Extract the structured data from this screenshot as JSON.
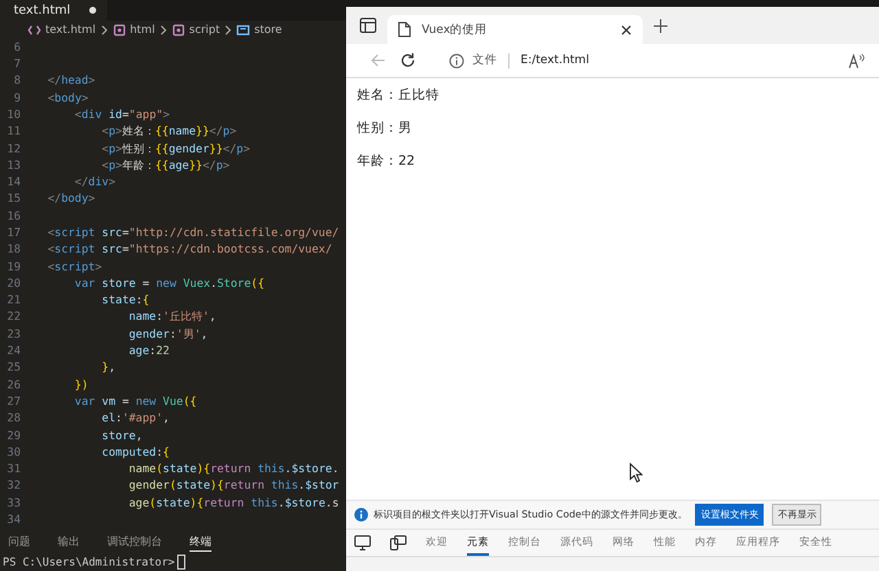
{
  "editor": {
    "tab": {
      "label": "text.html",
      "modified": true
    },
    "breadcrumb": [
      {
        "kind": "file",
        "label": "text.html"
      },
      {
        "kind": "element",
        "label": "html"
      },
      {
        "kind": "element",
        "label": "script"
      },
      {
        "kind": "variable",
        "label": "store"
      }
    ],
    "code": [
      {
        "number": "6"
      },
      {
        "number": "7"
      },
      {
        "number": "8",
        "tokens": [
          {
            "kind": "punct",
            "text": "    </"
          },
          {
            "kind": "tag",
            "text": "head"
          },
          {
            "kind": "punct",
            "text": ">"
          }
        ]
      },
      {
        "number": "9",
        "tokens": [
          {
            "kind": "punct",
            "text": "    <"
          },
          {
            "kind": "tag",
            "text": "body"
          },
          {
            "kind": "punct",
            "text": ">"
          }
        ]
      },
      {
        "number": "10",
        "tokens": [
          {
            "kind": "punct",
            "text": "        <"
          },
          {
            "kind": "tag",
            "text": "div"
          },
          {
            "kind": "attr",
            "text": " id"
          },
          {
            "kind": "plain",
            "text": "="
          },
          {
            "kind": "str",
            "text": "\"app\""
          },
          {
            "kind": "punct",
            "text": ">"
          }
        ]
      },
      {
        "number": "11",
        "tokens": [
          {
            "kind": "punct",
            "text": "            <"
          },
          {
            "kind": "tag",
            "text": "p"
          },
          {
            "kind": "punct",
            "text": ">"
          },
          {
            "kind": "plain",
            "text": "姓名："
          },
          {
            "kind": "brace",
            "text": "{{"
          },
          {
            "kind": "var",
            "text": "name"
          },
          {
            "kind": "brace",
            "text": "}}"
          },
          {
            "kind": "punct",
            "text": "</"
          },
          {
            "kind": "tag",
            "text": "p"
          },
          {
            "kind": "punct",
            "text": ">"
          }
        ]
      },
      {
        "number": "12",
        "tokens": [
          {
            "kind": "punct",
            "text": "            <"
          },
          {
            "kind": "tag",
            "text": "p"
          },
          {
            "kind": "punct",
            "text": ">"
          },
          {
            "kind": "plain",
            "text": "性别："
          },
          {
            "kind": "brace",
            "text": "{{"
          },
          {
            "kind": "var",
            "text": "gender"
          },
          {
            "kind": "brace",
            "text": "}}"
          },
          {
            "kind": "punct",
            "text": "</"
          },
          {
            "kind": "tag",
            "text": "p"
          },
          {
            "kind": "punct",
            "text": ">"
          }
        ]
      },
      {
        "number": "13",
        "tokens": [
          {
            "kind": "punct",
            "text": "            <"
          },
          {
            "kind": "tag",
            "text": "p"
          },
          {
            "kind": "punct",
            "text": ">"
          },
          {
            "kind": "plain",
            "text": "年龄："
          },
          {
            "kind": "brace",
            "text": "{{"
          },
          {
            "kind": "var",
            "text": "age"
          },
          {
            "kind": "brace",
            "text": "}}"
          },
          {
            "kind": "punct",
            "text": "</"
          },
          {
            "kind": "tag",
            "text": "p"
          },
          {
            "kind": "punct",
            "text": ">"
          }
        ]
      },
      {
        "number": "14",
        "tokens": [
          {
            "kind": "punct",
            "text": "        </"
          },
          {
            "kind": "tag",
            "text": "div"
          },
          {
            "kind": "punct",
            "text": ">"
          }
        ]
      },
      {
        "number": "15",
        "tokens": [
          {
            "kind": "punct",
            "text": "    </"
          },
          {
            "kind": "tag",
            "text": "body"
          },
          {
            "kind": "punct",
            "text": ">"
          }
        ]
      },
      {
        "number": "16"
      },
      {
        "number": "17",
        "tokens": [
          {
            "kind": "punct",
            "text": "    <"
          },
          {
            "kind": "tag",
            "text": "script"
          },
          {
            "kind": "attr",
            "text": " src"
          },
          {
            "kind": "plain",
            "text": "="
          },
          {
            "kind": "str",
            "text": "\"http://cdn.staticfile.org/vue/"
          }
        ]
      },
      {
        "number": "18",
        "tokens": [
          {
            "kind": "punct",
            "text": "    <"
          },
          {
            "kind": "tag",
            "text": "script"
          },
          {
            "kind": "attr",
            "text": " src"
          },
          {
            "kind": "plain",
            "text": "="
          },
          {
            "kind": "str",
            "text": "\"https://cdn.bootcss.com/vuex/"
          }
        ]
      },
      {
        "number": "19",
        "tokens": [
          {
            "kind": "punct",
            "text": "    <"
          },
          {
            "kind": "tag",
            "text": "script"
          },
          {
            "kind": "punct",
            "text": ">"
          }
        ]
      },
      {
        "number": "20",
        "tokens": [
          {
            "kind": "keyword",
            "text": "        var"
          },
          {
            "kind": "var",
            "text": " store"
          },
          {
            "kind": "plain",
            "text": " = "
          },
          {
            "kind": "keyword",
            "text": "new"
          },
          {
            "kind": "cls",
            "text": " Vuex"
          },
          {
            "kind": "plain",
            "text": "."
          },
          {
            "kind": "cls",
            "text": "Store"
          },
          {
            "kind": "brace",
            "text": "({"
          }
        ]
      },
      {
        "number": "21",
        "tokens": [
          {
            "kind": "var",
            "text": "            state"
          },
          {
            "kind": "plain",
            "text": ":"
          },
          {
            "kind": "brace",
            "text": "{"
          }
        ]
      },
      {
        "number": "22",
        "tokens": [
          {
            "kind": "var",
            "text": "                name"
          },
          {
            "kind": "plain",
            "text": ":"
          },
          {
            "kind": "str",
            "text": "'丘比特'"
          },
          {
            "kind": "plain",
            "text": ","
          }
        ]
      },
      {
        "number": "23",
        "tokens": [
          {
            "kind": "var",
            "text": "                gender"
          },
          {
            "kind": "plain",
            "text": ":"
          },
          {
            "kind": "str",
            "text": "'男'"
          },
          {
            "kind": "plain",
            "text": ","
          }
        ]
      },
      {
        "number": "24",
        "tokens": [
          {
            "kind": "var",
            "text": "                age"
          },
          {
            "kind": "plain",
            "text": ":"
          },
          {
            "kind": "num",
            "text": "22"
          }
        ]
      },
      {
        "number": "25",
        "tokens": [
          {
            "kind": "brace",
            "text": "            }"
          },
          {
            "kind": "plain",
            "text": ","
          }
        ]
      },
      {
        "number": "26",
        "tokens": [
          {
            "kind": "brace",
            "text": "        })"
          }
        ]
      },
      {
        "number": "27",
        "tokens": [
          {
            "kind": "keyword",
            "text": "        var"
          },
          {
            "kind": "var",
            "text": " vm"
          },
          {
            "kind": "plain",
            "text": " = "
          },
          {
            "kind": "keyword",
            "text": "new"
          },
          {
            "kind": "cls",
            "text": " Vue"
          },
          {
            "kind": "brace",
            "text": "({"
          }
        ]
      },
      {
        "number": "28",
        "tokens": [
          {
            "kind": "var",
            "text": "            el"
          },
          {
            "kind": "plain",
            "text": ":"
          },
          {
            "kind": "str",
            "text": "'#app'"
          },
          {
            "kind": "plain",
            "text": ","
          }
        ]
      },
      {
        "number": "29",
        "tokens": [
          {
            "kind": "var",
            "text": "            store"
          },
          {
            "kind": "plain",
            "text": ","
          }
        ]
      },
      {
        "number": "30",
        "tokens": [
          {
            "kind": "var",
            "text": "            computed"
          },
          {
            "kind": "plain",
            "text": ":"
          },
          {
            "kind": "brace",
            "text": "{"
          }
        ]
      },
      {
        "number": "31",
        "tokens": [
          {
            "kind": "fn",
            "text": "                name"
          },
          {
            "kind": "brace",
            "text": "("
          },
          {
            "kind": "var",
            "text": "state"
          },
          {
            "kind": "brace",
            "text": ")"
          },
          {
            "kind": "brace",
            "text": "{"
          },
          {
            "kind": "ctrl",
            "text": "return"
          },
          {
            "kind": "keyword",
            "text": " this"
          },
          {
            "kind": "plain",
            "text": "."
          },
          {
            "kind": "var",
            "text": "$store"
          },
          {
            "kind": "plain",
            "text": "."
          }
        ]
      },
      {
        "number": "32",
        "tokens": [
          {
            "kind": "fn",
            "text": "                gender"
          },
          {
            "kind": "brace",
            "text": "("
          },
          {
            "kind": "var",
            "text": "state"
          },
          {
            "kind": "brace",
            "text": ")"
          },
          {
            "kind": "brace",
            "text": "{"
          },
          {
            "kind": "ctrl",
            "text": "return"
          },
          {
            "kind": "keyword",
            "text": " this"
          },
          {
            "kind": "plain",
            "text": "."
          },
          {
            "kind": "var",
            "text": "$stor"
          }
        ]
      },
      {
        "number": "33",
        "tokens": [
          {
            "kind": "fn",
            "text": "                age"
          },
          {
            "kind": "brace",
            "text": "("
          },
          {
            "kind": "var",
            "text": "state"
          },
          {
            "kind": "brace",
            "text": ")"
          },
          {
            "kind": "brace",
            "text": "{"
          },
          {
            "kind": "ctrl",
            "text": "return"
          },
          {
            "kind": "keyword",
            "text": " this"
          },
          {
            "kind": "plain",
            "text": "."
          },
          {
            "kind": "var",
            "text": "$store"
          },
          {
            "kind": "plain",
            "text": ".s"
          }
        ]
      },
      {
        "number": "34"
      }
    ],
    "panel_tabs": [
      {
        "label": "问题",
        "selected": false
      },
      {
        "label": "输出",
        "selected": false
      },
      {
        "label": "调试控制台",
        "selected": false
      },
      {
        "label": "终端",
        "selected": true
      }
    ],
    "terminal": {
      "prompt": "PS C:\\Users\\Administrator>"
    }
  },
  "browser": {
    "tabs": [
      {
        "title": "Vuex的使用",
        "selected": true
      }
    ],
    "address": {
      "security_label": "文件",
      "url": "E:/text.html"
    },
    "page_lines": [
      "姓名：丘比特",
      "性别：男",
      "年龄：22"
    ],
    "infobar": {
      "message": "标识项目的根文件夹以打开Visual Studio Code中的源文件并同步更改。",
      "buttons": [
        {
          "label": "设置根文件夹",
          "primary": true
        },
        {
          "label": "不再显示",
          "primary": false
        }
      ]
    },
    "devtools_tabs": [
      {
        "label": "欢迎",
        "selected": false
      },
      {
        "label": "元素",
        "selected": true
      },
      {
        "label": "控制台",
        "selected": false
      },
      {
        "label": "源代码",
        "selected": false
      },
      {
        "label": "网络",
        "selected": false
      },
      {
        "label": "性能",
        "selected": false
      },
      {
        "label": "内存",
        "selected": false
      },
      {
        "label": "应用程序",
        "selected": false
      },
      {
        "label": "安全性",
        "selected": false
      }
    ]
  }
}
